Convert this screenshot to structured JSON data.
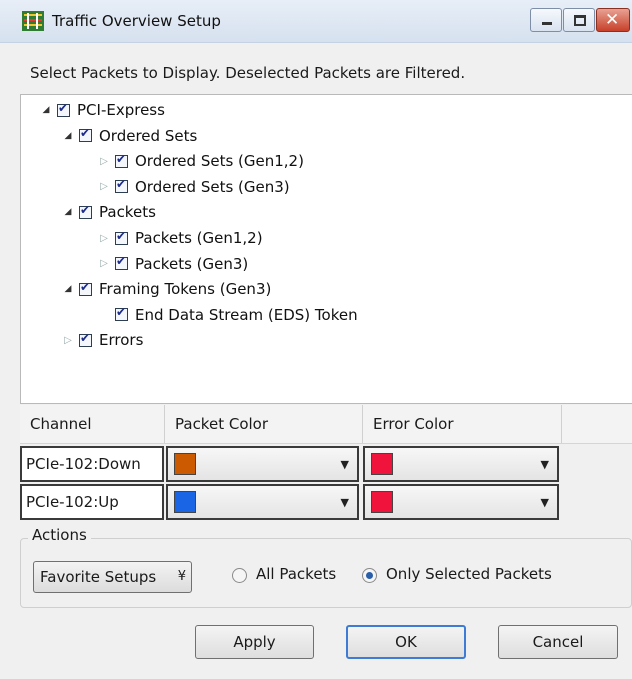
{
  "window": {
    "title": "Traffic Overview Setup",
    "controls": [
      "minimize",
      "maximize",
      "close"
    ]
  },
  "instruction": "Select Packets to Display. Deselected Packets are Filtered.",
  "tree": [
    {
      "label": "PCI-Express",
      "level": 0,
      "expander": "expanded",
      "checked": true
    },
    {
      "label": "Ordered Sets",
      "level": 1,
      "expander": "expanded",
      "checked": true
    },
    {
      "label": "Ordered Sets (Gen1,2)",
      "level": 2,
      "expander": "collapsed",
      "checked": true
    },
    {
      "label": "Ordered Sets (Gen3)",
      "level": 2,
      "expander": "collapsed",
      "checked": true
    },
    {
      "label": "Packets",
      "level": 1,
      "expander": "expanded",
      "checked": true
    },
    {
      "label": "Packets (Gen1,2)",
      "level": 2,
      "expander": "collapsed",
      "checked": true
    },
    {
      "label": "Packets (Gen3)",
      "level": 2,
      "expander": "collapsed",
      "checked": true
    },
    {
      "label": "Framing Tokens (Gen3)",
      "level": 1,
      "expander": "expanded",
      "checked": true
    },
    {
      "label": "End Data Stream (EDS) Token",
      "level": 2,
      "expander": "none",
      "checked": true
    },
    {
      "label": "Errors",
      "level": 1,
      "expander": "collapsed",
      "checked": true
    }
  ],
  "grid": {
    "headers": [
      "Channel",
      "Packet Color",
      "Error Color"
    ],
    "rows": [
      {
        "channel": "PCIe-102:Down",
        "packet_color": "#cc5a00",
        "error_color": "#f0143c"
      },
      {
        "channel": "PCIe-102:Up",
        "packet_color": "#1a64e6",
        "error_color": "#f0143c"
      }
    ]
  },
  "actions": {
    "title": "Actions",
    "favorite_label": "Favorite Setups",
    "radio_all": "All Packets",
    "radio_selected": "Only Selected Packets",
    "selected_option": "Only Selected Packets"
  },
  "buttons": {
    "apply": "Apply",
    "ok": "OK",
    "cancel": "Cancel"
  }
}
